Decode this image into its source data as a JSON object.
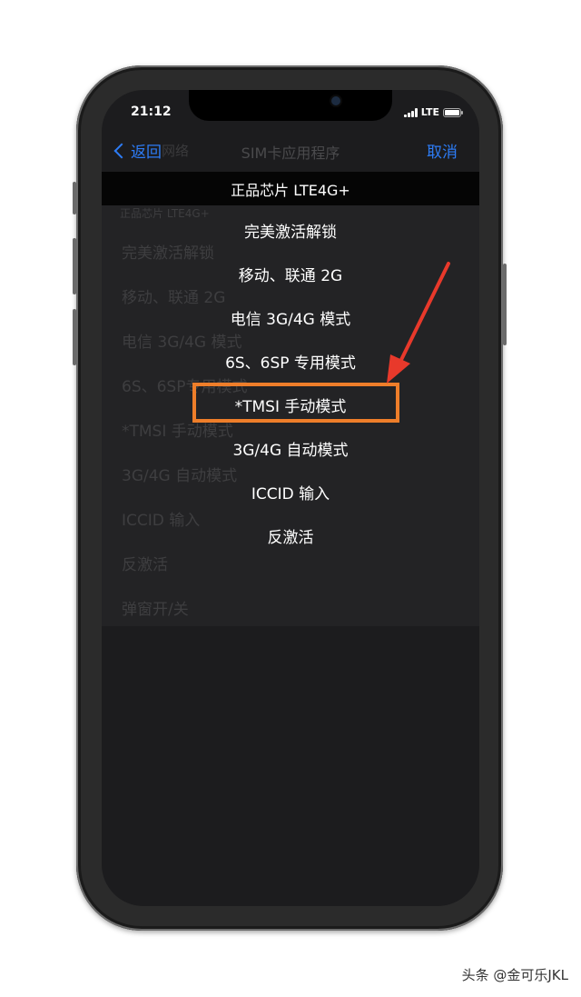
{
  "status_bar": {
    "time": "21:12",
    "network": "LTE",
    "signal_icon": "signal-icon",
    "battery_icon": "battery-icon"
  },
  "nav": {
    "back_label": "返回",
    "back_sub_label": "网络",
    "title": "SIM卡应用程序",
    "cancel_label": "取消"
  },
  "background_list": {
    "header": "正品芯片 LTE4G+",
    "items": [
      "完美激活解锁",
      "移动、联通 2G",
      "电信 3G/4G 模式",
      "6S、6SP专用模式",
      "*TMSI 手动模式",
      "3G/4G 自动模式",
      "ICCID 输入",
      "反激活",
      "弹窗开/关"
    ]
  },
  "action_sheet": {
    "header": "正品芯片 LTE4G+",
    "items": [
      "完美激活解锁",
      "移动、联通 2G",
      "电信 3G/4G 模式",
      "6S、6SP 专用模式",
      "*TMSI 手动模式",
      "3G/4G 自动模式",
      "ICCID 输入",
      "反激活"
    ],
    "highlighted_index": 4
  },
  "annotation": {
    "highlight_color": "#ee7e2a",
    "arrow_color": "#e8392b"
  },
  "colors": {
    "accent": "#2d7cf6",
    "screen_bg": "#1c1c1e"
  },
  "watermark": "头条 @金可乐JKL"
}
